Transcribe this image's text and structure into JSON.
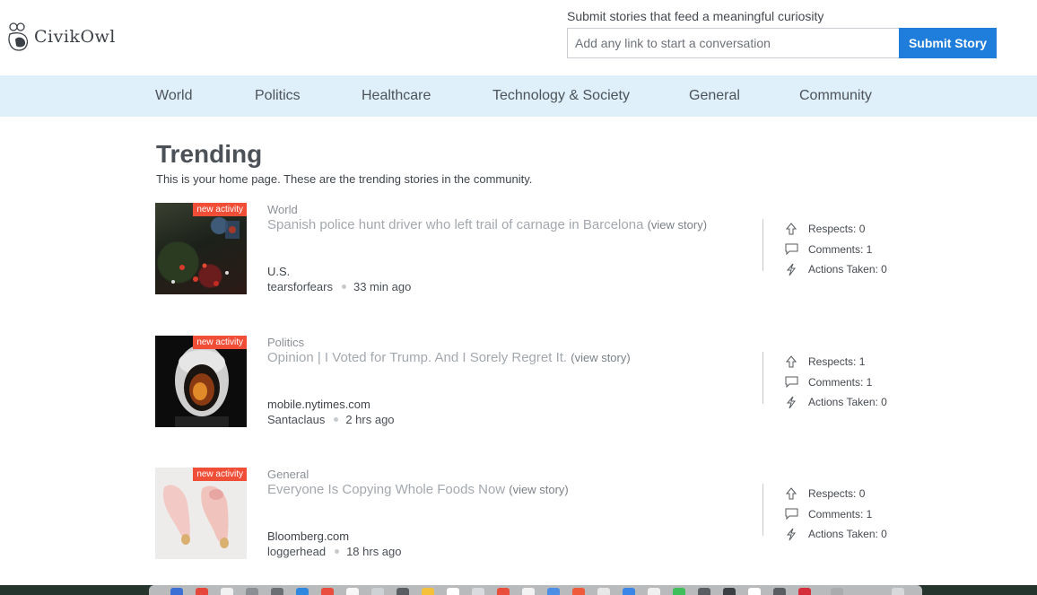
{
  "header": {
    "logo_text": "CivikOwl",
    "submit_caption": "Submit stories that feed a meaningful curiosity",
    "submit_placeholder": "Add any link to start a conversation",
    "submit_button": "Submit Story"
  },
  "nav": {
    "items": [
      {
        "label": "World"
      },
      {
        "label": "Politics"
      },
      {
        "label": "Healthcare"
      },
      {
        "label": "Technology & Society"
      },
      {
        "label": "General"
      },
      {
        "label": "Community"
      }
    ]
  },
  "main": {
    "title": "Trending",
    "subtitle": "This is your home page. These are the trending stories in the community."
  },
  "stories": [
    {
      "badge": "new activity",
      "category": "World",
      "headline": "Spanish police hunt driver who left trail of carnage in Barcelona",
      "view_label": "(view story)",
      "source": "U.S.",
      "user": "tearsforfears",
      "time": "33 min ago",
      "respects": "Respects: 0",
      "comments": "Comments: 1",
      "actions": "Actions Taken: 0"
    },
    {
      "badge": "new activity",
      "category": "Politics",
      "headline": "Opinion | I Voted for Trump. And I Sorely Regret It.",
      "view_label": "(view story)",
      "source": "mobile.nytimes.com",
      "user": "Santaclaus",
      "time": "2 hrs ago",
      "respects": "Respects: 1",
      "comments": "Comments: 1",
      "actions": "Actions Taken: 0"
    },
    {
      "badge": "new activity",
      "category": "General",
      "headline": "Everyone Is Copying Whole Foods Now",
      "view_label": "(view story)",
      "source": "Bloomberg.com",
      "user": "loggerhead",
      "time": "18 hrs ago",
      "respects": "Respects: 0",
      "comments": "Comments: 1",
      "actions": "Actions Taken: 0"
    }
  ],
  "colors": {
    "accent": "#1f7ddb",
    "nav_bg": "#dff0fb",
    "badge": "#f04e37"
  }
}
